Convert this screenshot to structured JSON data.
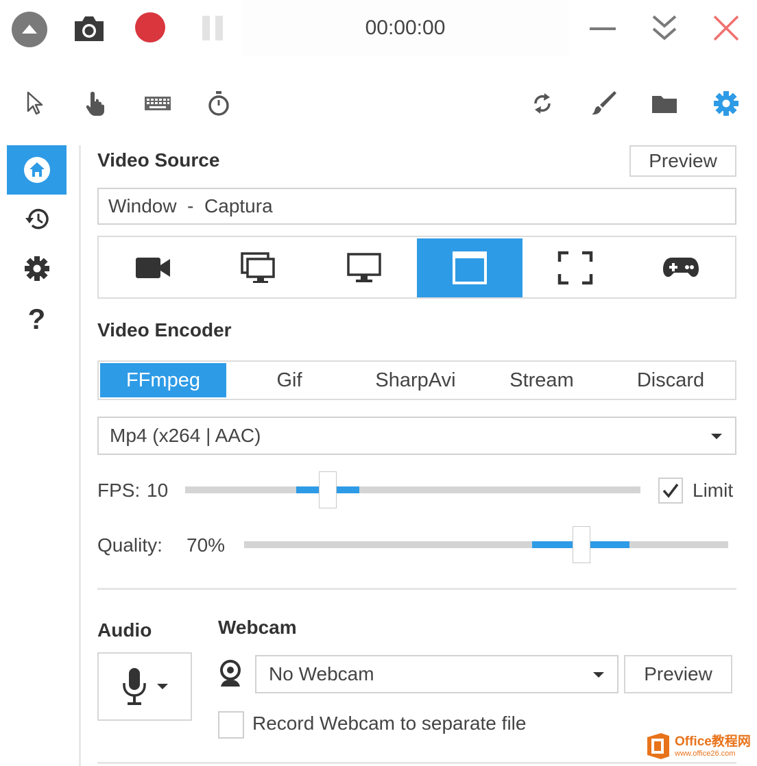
{
  "titlebar": {
    "timer": "00:00:00"
  },
  "toolbar_icons": [
    "cursor-icon",
    "click-hand-icon",
    "keyboard-icon",
    "stopwatch-icon",
    "refresh-icon",
    "brush-icon",
    "folder-icon",
    "gear-icon"
  ],
  "colors": {
    "accent": "#2e9be6",
    "record": "#d9363e",
    "close": "#f07070"
  },
  "video_source": {
    "title": "Video Source",
    "preview_label": "Preview",
    "current": "Window  -  Captura",
    "sources": [
      "camera-icon",
      "screens-icon",
      "monitor-icon",
      "window-icon",
      "region-icon",
      "gamepad-icon"
    ],
    "selected": "window-icon"
  },
  "video_encoder": {
    "title": "Video Encoder",
    "tabs": [
      "FFmpeg",
      "Gif",
      "SharpAvi",
      "Stream",
      "Discard"
    ],
    "selected_tab": "FFmpeg",
    "format": "Mp4 (x264 | AAC)",
    "fps_label": "FPS:",
    "fps_value": "10",
    "limit_label": "Limit",
    "limit_checked": true,
    "quality_label": "Quality:",
    "quality_value": "70%"
  },
  "audio": {
    "title": "Audio"
  },
  "webcam": {
    "title": "Webcam",
    "selected": "No Webcam",
    "preview_label": "Preview",
    "separate_file_label": "Record Webcam to separate file",
    "separate_file_checked": false
  },
  "watermark": {
    "name": "Office教程网",
    "url": "www.office26.com"
  }
}
